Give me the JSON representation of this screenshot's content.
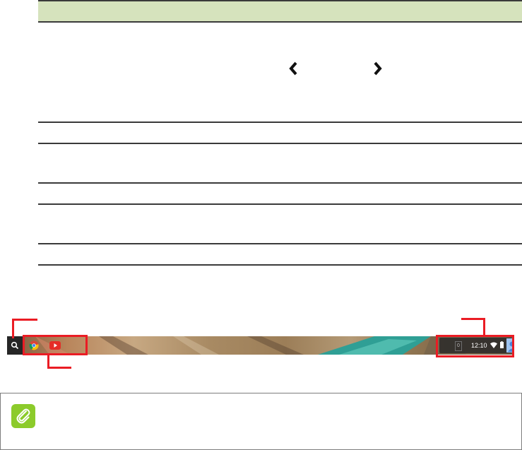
{
  "table": {
    "prev_icon": "chevron-left-icon",
    "next_icon": "chevron-right-icon"
  },
  "shelf": {
    "launcher_icon": "search-icon",
    "apps": [
      "chrome-icon",
      "youtube-icon"
    ],
    "status": {
      "clock": "12:10",
      "notification_count": "0",
      "wifi_icon": "wifi-icon",
      "battery_icon": "battery-icon",
      "avatar_icon": "avatar-icon"
    }
  },
  "callouts": {
    "color": "#ea1c24"
  },
  "note": {
    "icon": "paperclip-icon",
    "icon_color": "#8ccb2b"
  }
}
